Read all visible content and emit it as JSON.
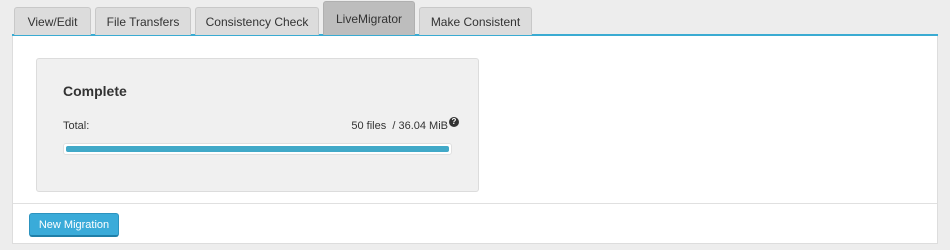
{
  "tabs": [
    {
      "label": "View/Edit",
      "active": false
    },
    {
      "label": "File Transfers",
      "active": false
    },
    {
      "label": "Consistency Check",
      "active": false
    },
    {
      "label": "LiveMigrator",
      "active": true
    },
    {
      "label": "Make Consistent",
      "active": false
    }
  ],
  "status_card": {
    "title": "Complete",
    "total_label": "Total:",
    "total_value": "50 files  / 36.04 MiB",
    "help_icon": "question-circle-icon",
    "progress_percent": 100
  },
  "actions": {
    "new_migration_label": "New Migration"
  },
  "colors": {
    "accent": "#3aabd2",
    "progress": "#41a9c8",
    "button": "#3aabd9"
  }
}
